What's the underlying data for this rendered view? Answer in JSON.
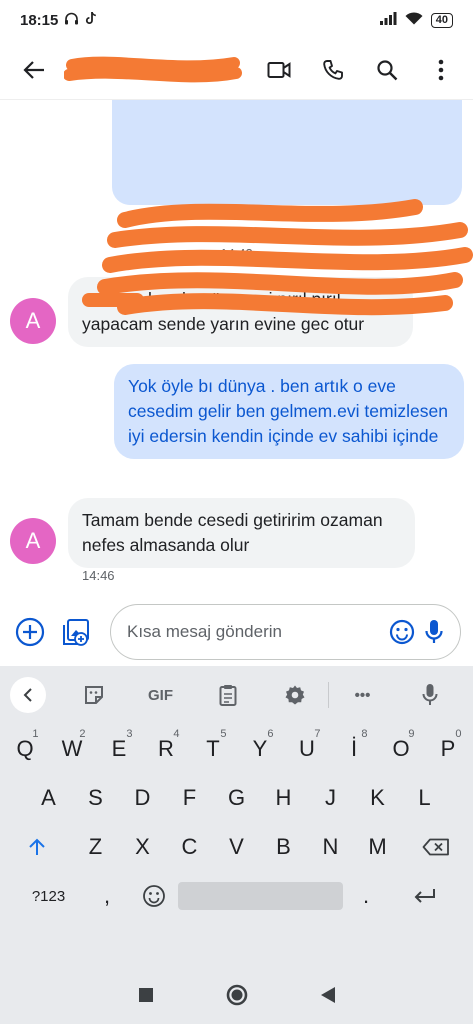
{
  "status": {
    "time": "18:15",
    "battery": "40"
  },
  "convo": {
    "time_separator": "14:43",
    "messages": [
      {
        "direction": "incoming",
        "avatar": "A",
        "text": "ben bugün o evi pırıl pırıl yapacam sende yarın evine gec otur"
      },
      {
        "direction": "outgoing",
        "text": "Yok öyle bı dünya . ben artık o eve cesedim gelir ben gelmem.evi temizlesen iyi edersin kendin içinde ev sahibi içinde"
      },
      {
        "direction": "incoming",
        "avatar": "A",
        "text": "Tamam bende cesedi getiririm ozaman nefes almasanda olur",
        "time": "14:46"
      }
    ]
  },
  "compose": {
    "placeholder": "Kısa mesaj gönderin"
  },
  "keyboard": {
    "toolbar": {
      "gif": "GIF",
      "more": "•••"
    },
    "row1": [
      {
        "key": "Q",
        "hint": "1"
      },
      {
        "key": "W",
        "hint": "2"
      },
      {
        "key": "E",
        "hint": "3"
      },
      {
        "key": "R",
        "hint": "4"
      },
      {
        "key": "T",
        "hint": "5"
      },
      {
        "key": "Y",
        "hint": "6"
      },
      {
        "key": "U",
        "hint": "7"
      },
      {
        "key": "İ",
        "hint": "8"
      },
      {
        "key": "O",
        "hint": "9"
      },
      {
        "key": "P",
        "hint": "0"
      }
    ],
    "row2": [
      "A",
      "S",
      "D",
      "F",
      "G",
      "H",
      "J",
      "K",
      "L"
    ],
    "row3": [
      "Z",
      "X",
      "C",
      "V",
      "B",
      "N",
      "M"
    ],
    "bottom": {
      "symbols": "?123",
      "comma": ",",
      "period": "."
    }
  },
  "icons": {
    "back": "arrow-left-icon",
    "video": "video-call-icon",
    "phone": "phone-icon",
    "search": "search-icon",
    "menu": "more-vert-icon",
    "attach": "add-circle-icon",
    "gallery": "gallery-icon",
    "emoji": "emoji-icon",
    "mic": "mic-icon"
  },
  "colors": {
    "accent": "#0b57d0",
    "outgoing_bubble": "#d3e3fd",
    "incoming_bubble": "#f1f3f4",
    "avatar": "#e466c4",
    "redaction": "#f47a34"
  }
}
